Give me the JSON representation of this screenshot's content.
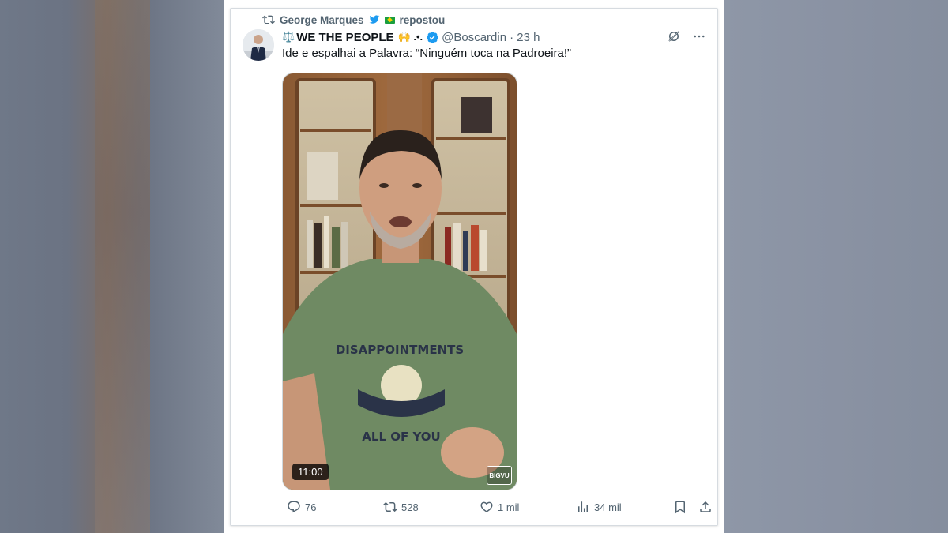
{
  "repost": {
    "user": "George Marques",
    "suffix": "repostou",
    "icon": "repost-icon"
  },
  "author": {
    "display_name": "WE THE PEOPLE",
    "prefix_emoji": "⚖️",
    "suffix_emoji": "🙌 .•.",
    "verified": true,
    "handle": "@Boscardin",
    "time": "· 23 h"
  },
  "tweet": {
    "text": "Ide e espalhai a Palavra: “Ninguém toca na Padroeira!”"
  },
  "media": {
    "duration": "11:00",
    "watermark": "BIGVU"
  },
  "actions": {
    "replies": "76",
    "reposts": "528",
    "likes": "1 mil",
    "views": "34 mil"
  },
  "colors": {
    "verified_blue": "#1d9bf0",
    "muted": "#536471",
    "text": "#0f1419"
  }
}
